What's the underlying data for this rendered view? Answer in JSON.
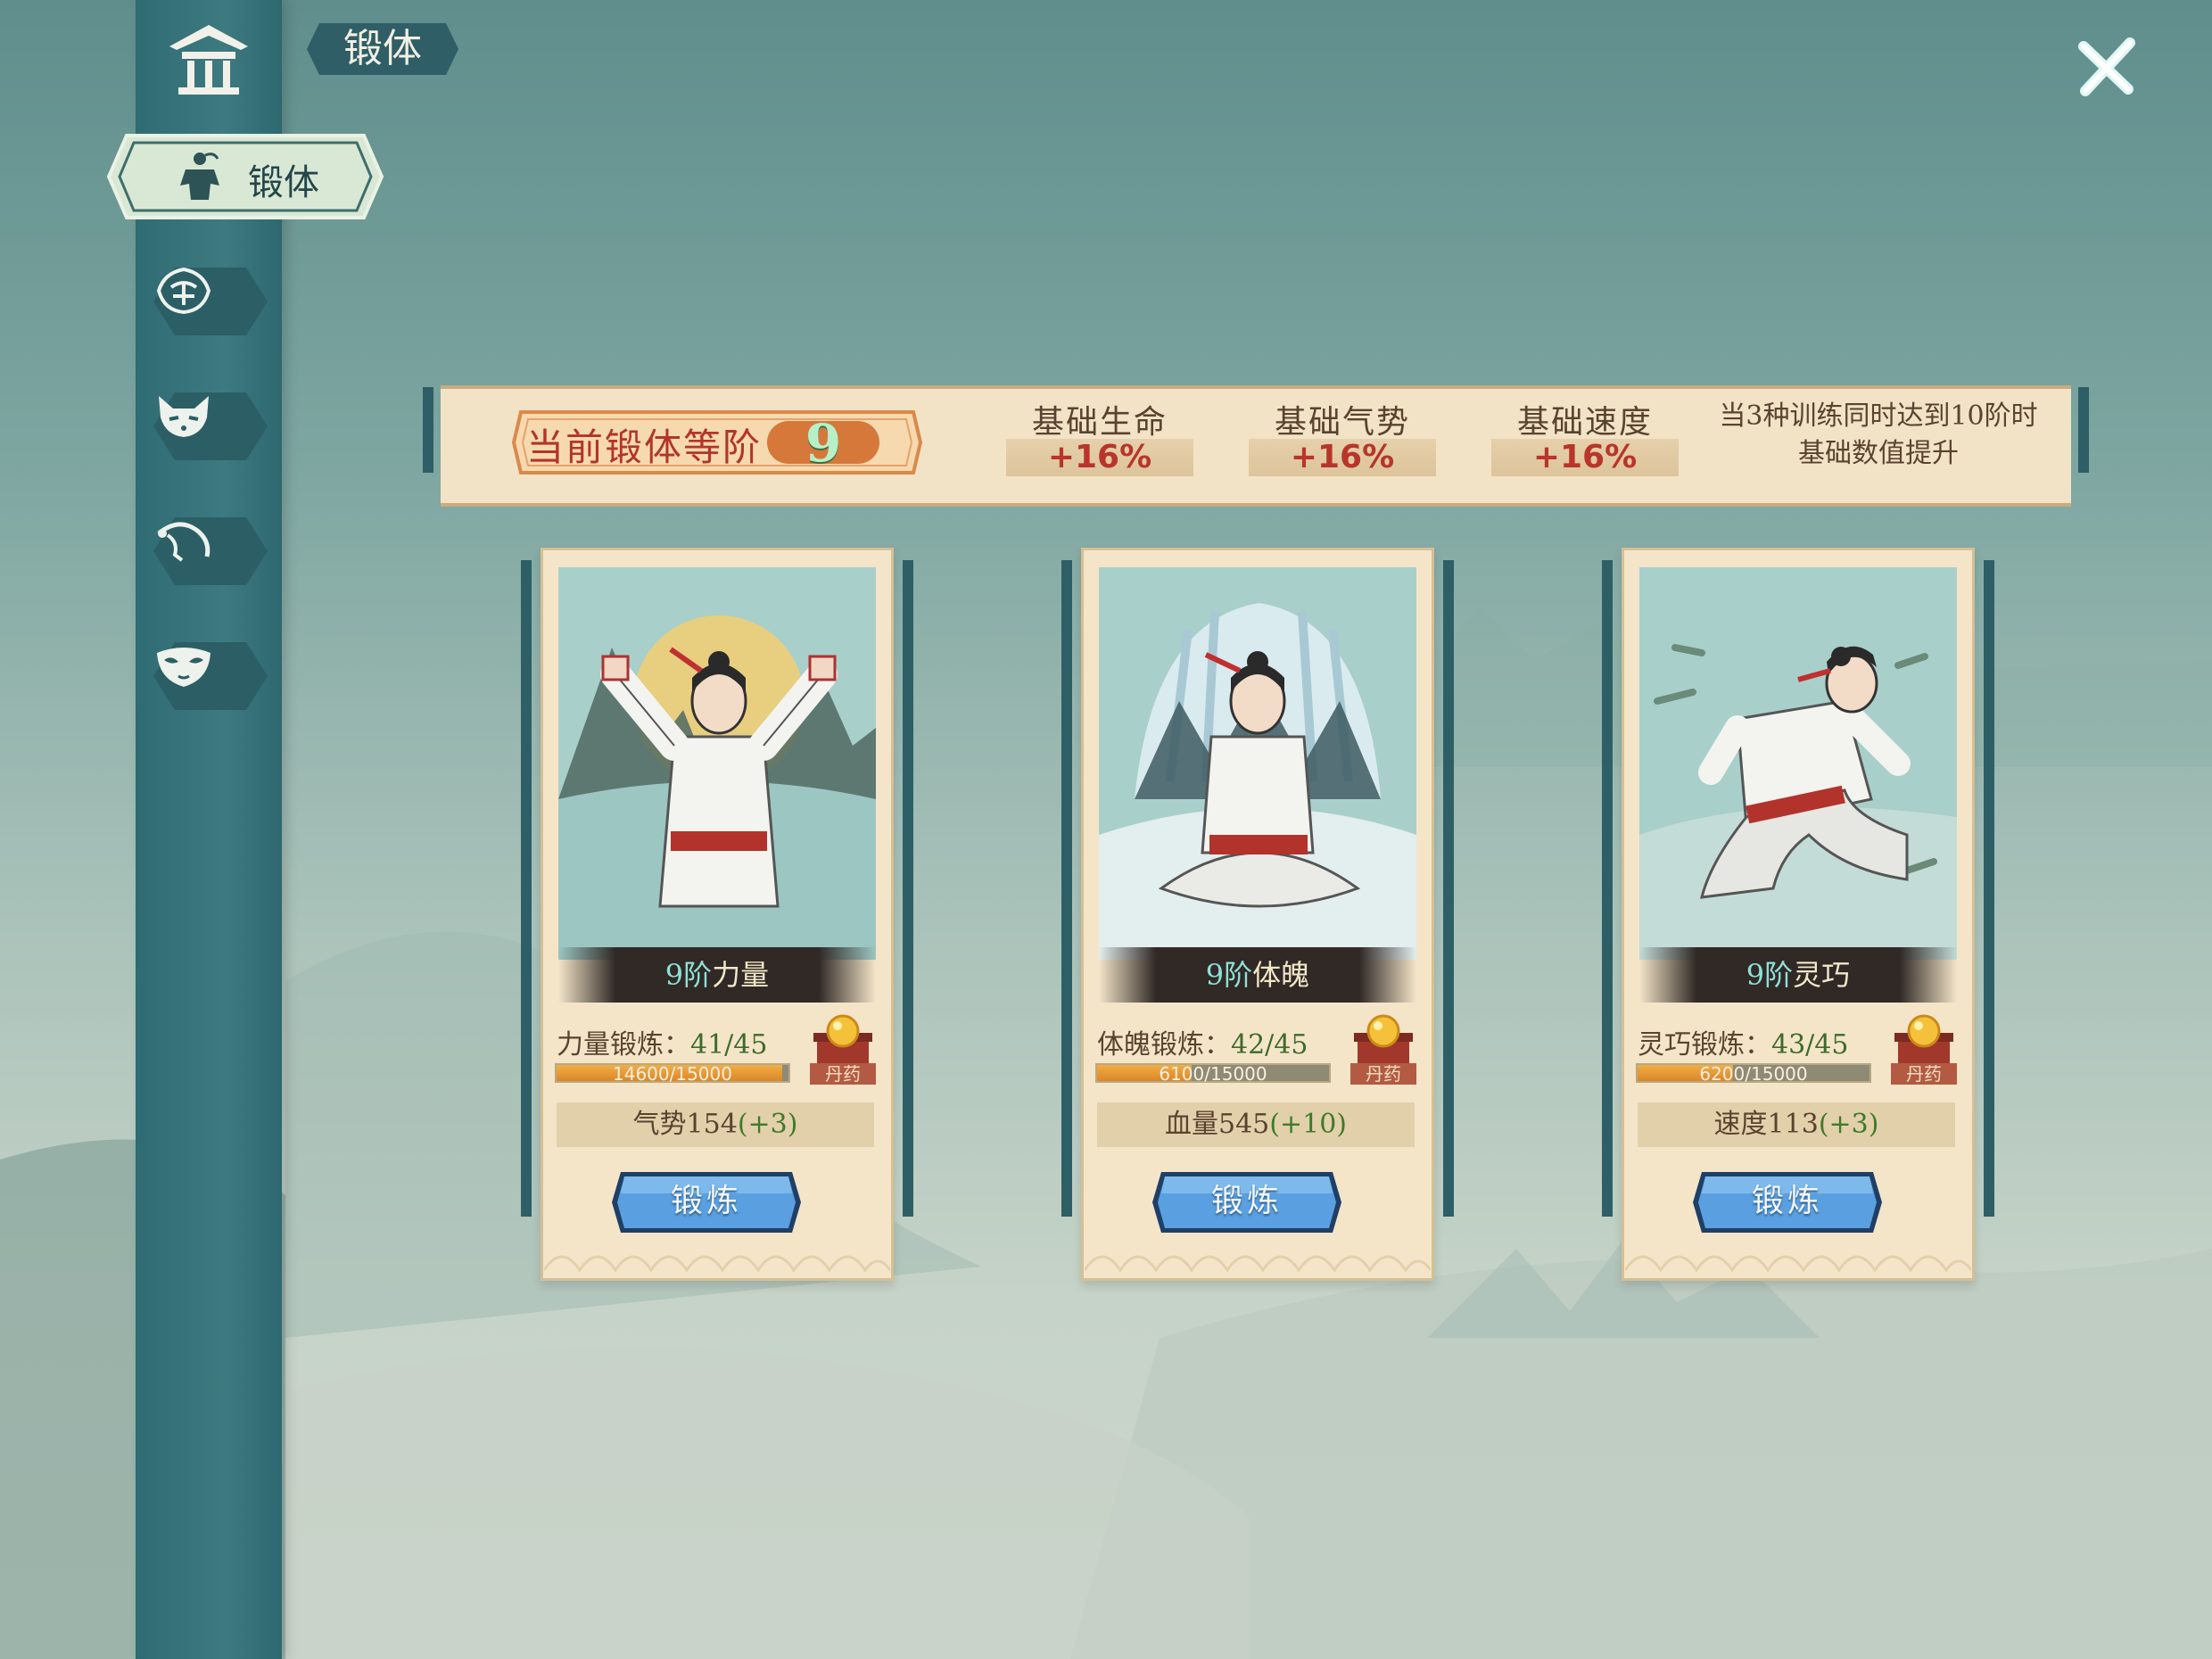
{
  "window": {
    "title": "锻体"
  },
  "sidebar": {
    "active_tab": {
      "label": "锻体",
      "icon": "martial-artist-icon"
    },
    "items": [
      {
        "icon": "pavilion-icon"
      },
      {
        "icon": "jue-emblem-icon"
      },
      {
        "icon": "fox-mask-icon"
      },
      {
        "icon": "whip-icon"
      },
      {
        "icon": "opera-mask-icon"
      }
    ]
  },
  "close": {
    "icon": "close-icon"
  },
  "banner": {
    "rank_label": "当前锻体等阶",
    "rank_value": "9",
    "stats": [
      {
        "name": "基础生命",
        "value": "+16%"
      },
      {
        "name": "基础气势",
        "value": "+16%"
      },
      {
        "name": "基础速度",
        "value": "+16%"
      }
    ],
    "note_line1": "当3种训练同时达到10阶时",
    "note_line2": "基础数值提升"
  },
  "cards": [
    {
      "level": "9阶",
      "name": "力量",
      "train_label": "力量锻炼：",
      "train_count": "41/45",
      "progress_text": "14600/15000",
      "progress": 0.973,
      "pill_label": "丹药",
      "bonus_text": "气势154",
      "bonus_plus": "(+3)",
      "button": "锻炼"
    },
    {
      "level": "9阶",
      "name": "体魄",
      "train_label": "体魄锻炼：",
      "train_count": "42/45",
      "progress_text": "6100/15000",
      "progress": 0.407,
      "pill_label": "丹药",
      "bonus_text": "血量545",
      "bonus_plus": "(+10)",
      "button": "锻炼"
    },
    {
      "level": "9阶",
      "name": "灵巧",
      "train_label": "灵巧锻炼：",
      "train_count": "43/45",
      "progress_text": "6200/15000",
      "progress": 0.413,
      "pill_label": "丹药",
      "bonus_text": "速度113",
      "bonus_plus": "(+3)",
      "button": "锻炼"
    }
  ],
  "colors": {
    "sidebar": "#3d7a80",
    "paper": "#f4e5c9",
    "accent_red": "#b8352b",
    "button_blue": "#4f8fd1"
  }
}
